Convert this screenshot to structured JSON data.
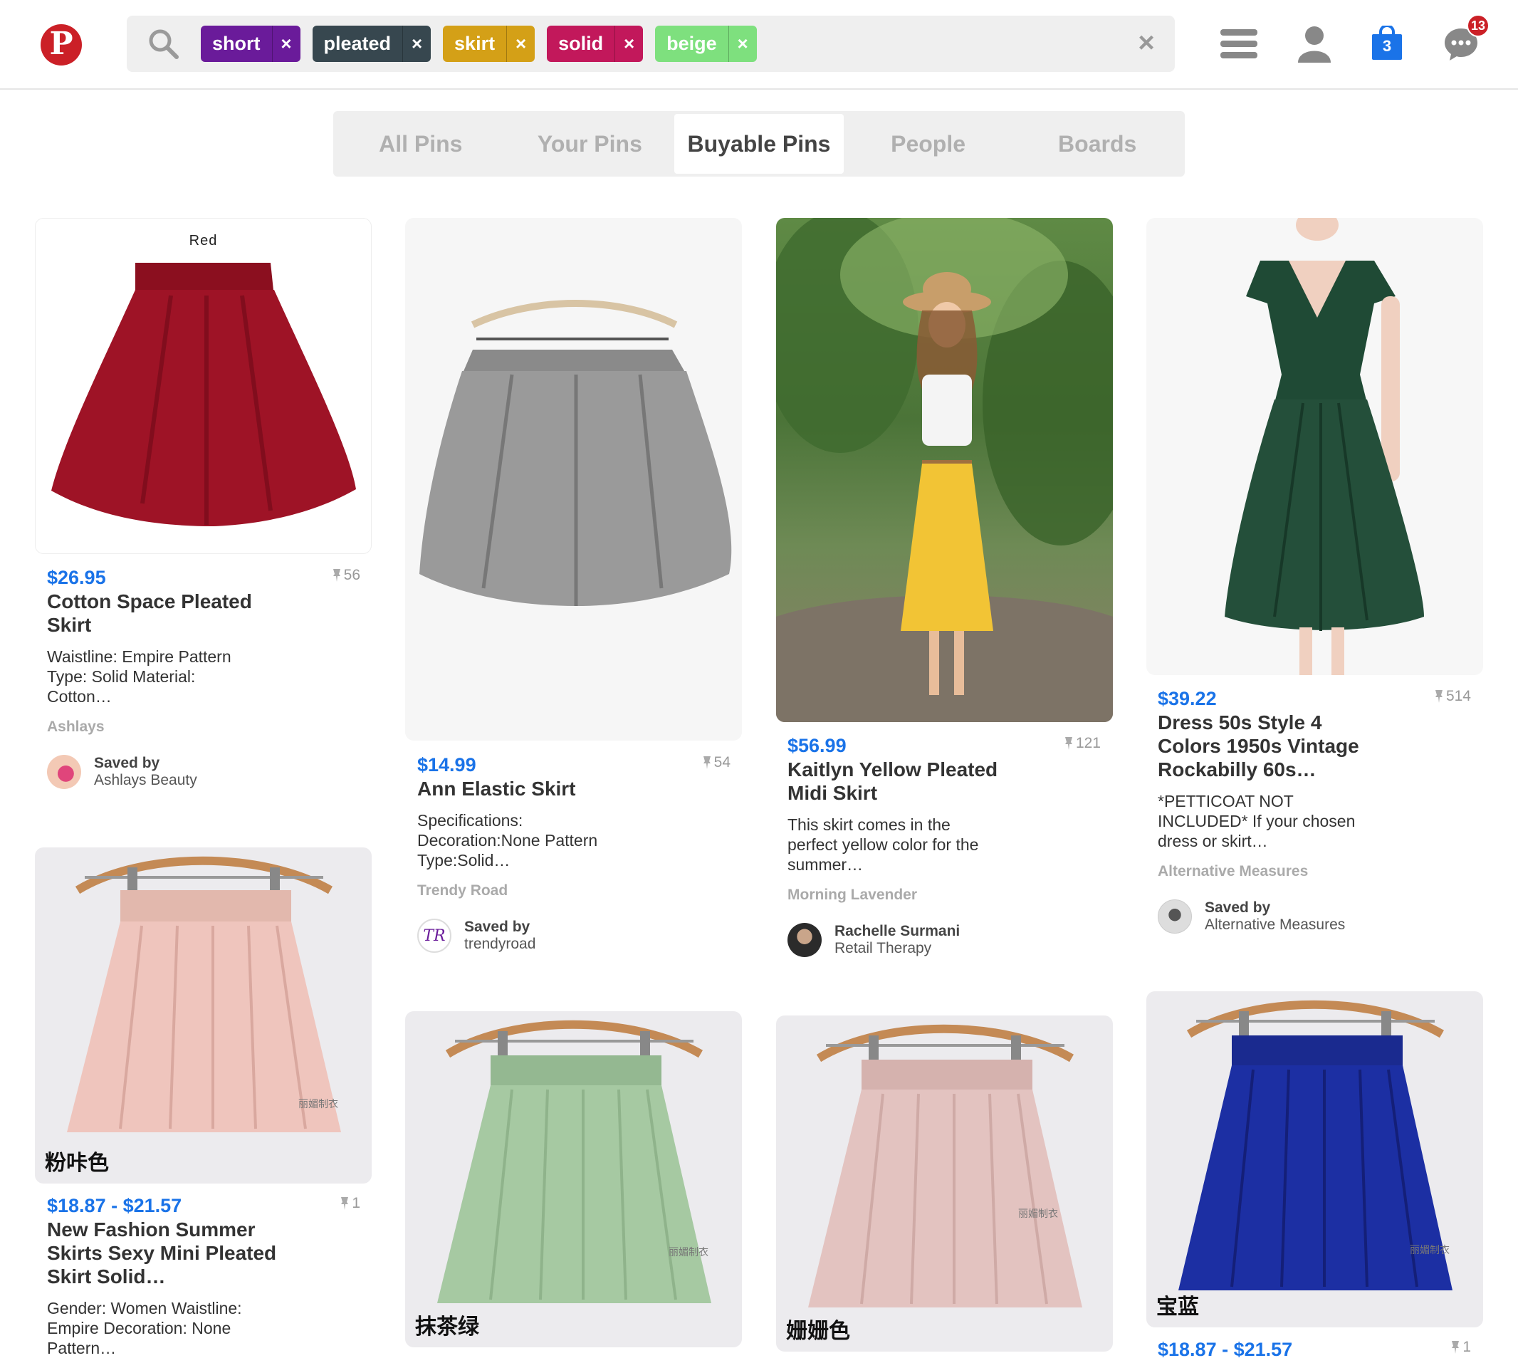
{
  "header": {
    "logo_icon": "pinterest-logo",
    "search": {
      "tags": [
        {
          "label": "short",
          "color": "#6a1b9a"
        },
        {
          "label": "pleated",
          "color": "#37474f"
        },
        {
          "label": "skirt",
          "color": "#d4a017"
        },
        {
          "label": "solid",
          "color": "#c2185b"
        },
        {
          "label": "beige",
          "color": "#7ee07e"
        }
      ],
      "remove_glyph": "×",
      "clear_glyph": "×"
    },
    "cart_count": "3",
    "notifications_count": "13"
  },
  "tabs": [
    {
      "label": "All Pins",
      "active": false
    },
    {
      "label": "Your Pins",
      "active": false
    },
    {
      "label": "Buyable Pins",
      "active": true
    },
    {
      "label": "People",
      "active": false
    },
    {
      "label": "Boards",
      "active": false
    }
  ],
  "pins": [
    {
      "image_overlay": "Red",
      "price": "$26.95",
      "repins": "56",
      "title": "Cotton Space Pleated Skirt",
      "description": "Waistline: Empire Pattern Type: Solid Material: Cotton…",
      "source": "Ashlays",
      "saved_by_label": "Saved by",
      "saved_by": "Ashlays Beauty"
    },
    {
      "price": "$14.99",
      "repins": "54",
      "title": "Ann Elastic Skirt",
      "description": "Specifications: Decoration:None Pattern Type:Solid…",
      "source": "Trendy Road",
      "saved_by_label": "Saved by",
      "saved_by": "trendyroad"
    },
    {
      "price": "$56.99",
      "repins": "121",
      "title": "Kaitlyn Yellow Pleated Midi Skirt",
      "description": "This skirt comes in the perfect yellow color for the summer…",
      "source": "Morning Lavender",
      "saved_by_label": "Rachelle Surmani",
      "saved_by": "Retail Therapy"
    },
    {
      "price": "$39.22",
      "repins": "514",
      "title": "Dress 50s Style 4 Colors 1950s Vintage Rockabilly 60s…",
      "description": "*PETTICOAT NOT INCLUDED* If your chosen dress or skirt…",
      "source": "Alternative Measures",
      "saved_by_label": "Saved by",
      "saved_by": "Alternative Measures"
    },
    {
      "image_overlay": "粉咔色",
      "watermark": "丽媚制衣",
      "price": "$18.87 - $21.57",
      "repins": "1",
      "title": "New Fashion Summer Skirts Sexy Mini Pleated Skirt Solid…",
      "description": "Gender: Women Waistline: Empire Decoration: None Pattern…"
    },
    {
      "image_overlay": "抹茶绿",
      "watermark": "丽媚制衣"
    },
    {
      "image_overlay": "姗姗色",
      "watermark": "丽媚制衣"
    },
    {
      "image_overlay": "宝蓝",
      "watermark": "丽媚制衣",
      "price": "$18.87 - $21.57",
      "repins": "1"
    }
  ]
}
